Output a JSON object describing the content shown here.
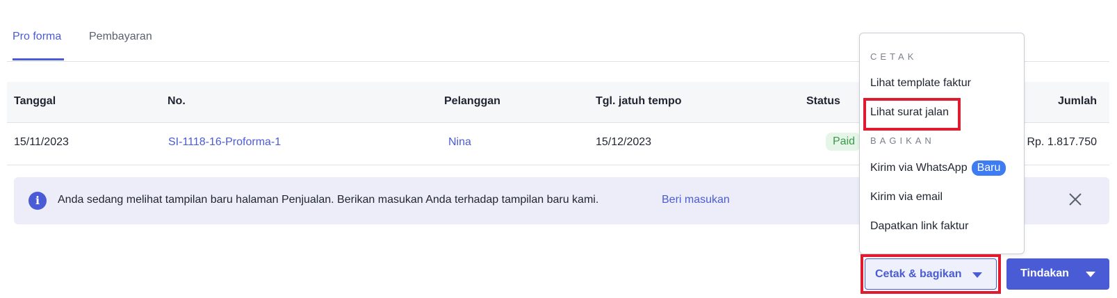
{
  "tabs": [
    {
      "label": "Pro forma",
      "active": true
    },
    {
      "label": "Pembayaran",
      "active": false
    }
  ],
  "table": {
    "columns": [
      "Tanggal",
      "No.",
      "Pelanggan",
      "Tgl. jatuh tempo",
      "Status",
      "Jumlah"
    ],
    "rows": [
      {
        "tanggal": "15/11/2023",
        "no": "SI-1118-16-Proforma-1",
        "pelanggan": "Nina",
        "jatuh_tempo": "15/12/2023",
        "status": "Paid",
        "jumlah": "Rp. 1.817.750"
      }
    ]
  },
  "banner": {
    "text": "Anda sedang melihat tampilan baru halaman Penjualan. Berikan masukan Anda terhadap tampilan baru kami.",
    "link": "Beri masukan",
    "info_icon": "i"
  },
  "menu": {
    "section_print": "CETAK",
    "items_print": [
      "Lihat template faktur",
      "Lihat surat jalan"
    ],
    "section_share": "BAGIKAN",
    "items_share": [
      "Kirim via WhatsApp",
      "Kirim via email",
      "Dapatkan link faktur"
    ],
    "new_badge": "Baru"
  },
  "actions": {
    "print_share": "Cetak & bagikan",
    "tindakan": "Tindakan"
  },
  "colors": {
    "accent": "#4a5bd6",
    "paid_bg": "#e5f5e8",
    "paid_text": "#3a9a4a",
    "highlight": "#e01b2f",
    "new_badge": "#3d7cf2"
  }
}
